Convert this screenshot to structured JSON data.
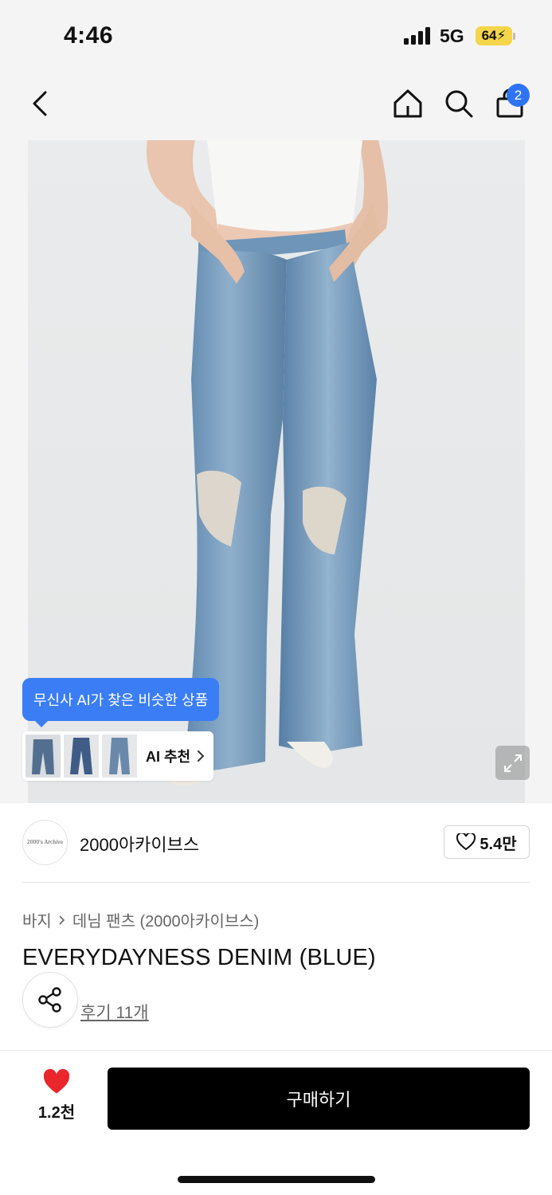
{
  "status": {
    "time": "4:46",
    "network": "5G",
    "battery": "64"
  },
  "nav": {
    "cart_count": "2",
    "icons": [
      "chevron-left-icon",
      "home-icon",
      "search-icon",
      "shopping-bag-icon"
    ]
  },
  "hero": {
    "ai_tooltip": "무신사 AI가 찾은 비슷한 상품",
    "ai_button": "AI 추천"
  },
  "brand": {
    "logo_text": "2000's Archive",
    "name": "2000아카이브스",
    "likes": "5.4만"
  },
  "product": {
    "breadcrumb": [
      "바지",
      "데님 팬츠 (2000아카이브스)"
    ],
    "title": "EVERYDAYNESS DENIM (BLUE)",
    "reviews": "후기 11개"
  },
  "bottom": {
    "wish_count": "1.2천",
    "buy_label": "구매하기"
  },
  "colors": {
    "accent": "#3a7df5",
    "heart": "#e8262b",
    "badge": "#2f73f5",
    "buy_button": "#000000"
  }
}
